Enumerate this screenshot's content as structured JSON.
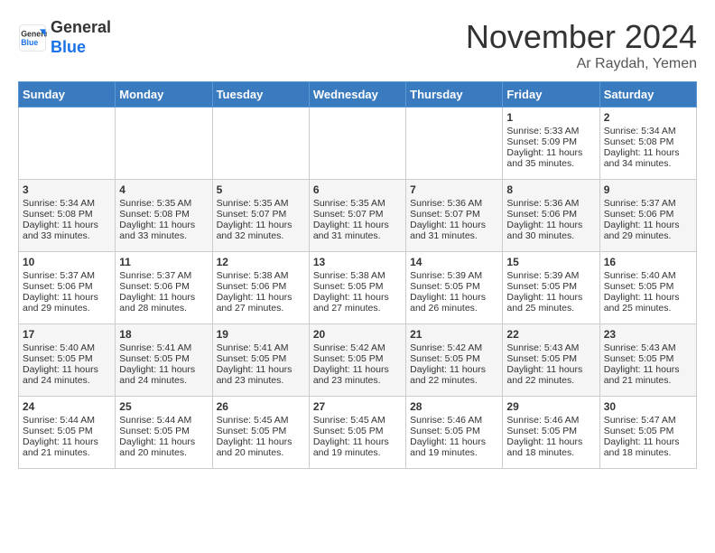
{
  "logo": {
    "line1": "General",
    "line2": "Blue"
  },
  "title": "November 2024",
  "location": "Ar Raydah, Yemen",
  "headers": [
    "Sunday",
    "Monday",
    "Tuesday",
    "Wednesday",
    "Thursday",
    "Friday",
    "Saturday"
  ],
  "weeks": [
    [
      {
        "day": "",
        "info": ""
      },
      {
        "day": "",
        "info": ""
      },
      {
        "day": "",
        "info": ""
      },
      {
        "day": "",
        "info": ""
      },
      {
        "day": "",
        "info": ""
      },
      {
        "day": "1",
        "info": "Sunrise: 5:33 AM\nSunset: 5:09 PM\nDaylight: 11 hours\nand 35 minutes."
      },
      {
        "day": "2",
        "info": "Sunrise: 5:34 AM\nSunset: 5:08 PM\nDaylight: 11 hours\nand 34 minutes."
      }
    ],
    [
      {
        "day": "3",
        "info": "Sunrise: 5:34 AM\nSunset: 5:08 PM\nDaylight: 11 hours\nand 33 minutes."
      },
      {
        "day": "4",
        "info": "Sunrise: 5:35 AM\nSunset: 5:08 PM\nDaylight: 11 hours\nand 33 minutes."
      },
      {
        "day": "5",
        "info": "Sunrise: 5:35 AM\nSunset: 5:07 PM\nDaylight: 11 hours\nand 32 minutes."
      },
      {
        "day": "6",
        "info": "Sunrise: 5:35 AM\nSunset: 5:07 PM\nDaylight: 11 hours\nand 31 minutes."
      },
      {
        "day": "7",
        "info": "Sunrise: 5:36 AM\nSunset: 5:07 PM\nDaylight: 11 hours\nand 31 minutes."
      },
      {
        "day": "8",
        "info": "Sunrise: 5:36 AM\nSunset: 5:06 PM\nDaylight: 11 hours\nand 30 minutes."
      },
      {
        "day": "9",
        "info": "Sunrise: 5:37 AM\nSunset: 5:06 PM\nDaylight: 11 hours\nand 29 minutes."
      }
    ],
    [
      {
        "day": "10",
        "info": "Sunrise: 5:37 AM\nSunset: 5:06 PM\nDaylight: 11 hours\nand 29 minutes."
      },
      {
        "day": "11",
        "info": "Sunrise: 5:37 AM\nSunset: 5:06 PM\nDaylight: 11 hours\nand 28 minutes."
      },
      {
        "day": "12",
        "info": "Sunrise: 5:38 AM\nSunset: 5:06 PM\nDaylight: 11 hours\nand 27 minutes."
      },
      {
        "day": "13",
        "info": "Sunrise: 5:38 AM\nSunset: 5:05 PM\nDaylight: 11 hours\nand 27 minutes."
      },
      {
        "day": "14",
        "info": "Sunrise: 5:39 AM\nSunset: 5:05 PM\nDaylight: 11 hours\nand 26 minutes."
      },
      {
        "day": "15",
        "info": "Sunrise: 5:39 AM\nSunset: 5:05 PM\nDaylight: 11 hours\nand 25 minutes."
      },
      {
        "day": "16",
        "info": "Sunrise: 5:40 AM\nSunset: 5:05 PM\nDaylight: 11 hours\nand 25 minutes."
      }
    ],
    [
      {
        "day": "17",
        "info": "Sunrise: 5:40 AM\nSunset: 5:05 PM\nDaylight: 11 hours\nand 24 minutes."
      },
      {
        "day": "18",
        "info": "Sunrise: 5:41 AM\nSunset: 5:05 PM\nDaylight: 11 hours\nand 24 minutes."
      },
      {
        "day": "19",
        "info": "Sunrise: 5:41 AM\nSunset: 5:05 PM\nDaylight: 11 hours\nand 23 minutes."
      },
      {
        "day": "20",
        "info": "Sunrise: 5:42 AM\nSunset: 5:05 PM\nDaylight: 11 hours\nand 23 minutes."
      },
      {
        "day": "21",
        "info": "Sunrise: 5:42 AM\nSunset: 5:05 PM\nDaylight: 11 hours\nand 22 minutes."
      },
      {
        "day": "22",
        "info": "Sunrise: 5:43 AM\nSunset: 5:05 PM\nDaylight: 11 hours\nand 22 minutes."
      },
      {
        "day": "23",
        "info": "Sunrise: 5:43 AM\nSunset: 5:05 PM\nDaylight: 11 hours\nand 21 minutes."
      }
    ],
    [
      {
        "day": "24",
        "info": "Sunrise: 5:44 AM\nSunset: 5:05 PM\nDaylight: 11 hours\nand 21 minutes."
      },
      {
        "day": "25",
        "info": "Sunrise: 5:44 AM\nSunset: 5:05 PM\nDaylight: 11 hours\nand 20 minutes."
      },
      {
        "day": "26",
        "info": "Sunrise: 5:45 AM\nSunset: 5:05 PM\nDaylight: 11 hours\nand 20 minutes."
      },
      {
        "day": "27",
        "info": "Sunrise: 5:45 AM\nSunset: 5:05 PM\nDaylight: 11 hours\nand 19 minutes."
      },
      {
        "day": "28",
        "info": "Sunrise: 5:46 AM\nSunset: 5:05 PM\nDaylight: 11 hours\nand 19 minutes."
      },
      {
        "day": "29",
        "info": "Sunrise: 5:46 AM\nSunset: 5:05 PM\nDaylight: 11 hours\nand 18 minutes."
      },
      {
        "day": "30",
        "info": "Sunrise: 5:47 AM\nSunset: 5:05 PM\nDaylight: 11 hours\nand 18 minutes."
      }
    ]
  ]
}
